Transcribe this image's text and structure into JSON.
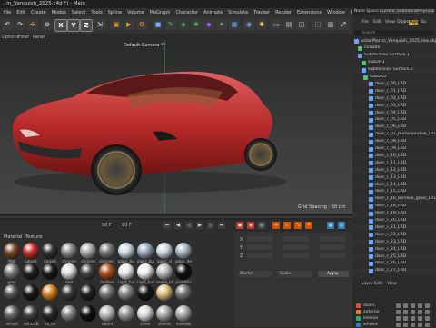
{
  "window": {
    "title": "...in_Vanquish_2025.c4d *] - Main"
  },
  "menubar": [
    "File",
    "Edit",
    "Create",
    "Modes",
    "Select",
    "Tools",
    "Spline",
    "Volume",
    "MoGraph",
    "Character",
    "Animate",
    "Simulate",
    "Tracker",
    "Render",
    "Extensions",
    "Window",
    "Help"
  ],
  "toolbar": {
    "axis_x": "X",
    "axis_y": "Y",
    "axis_z": "Z"
  },
  "viewport_menu": [
    "Options",
    "Filter",
    "Panel"
  ],
  "viewport": {
    "camera_label": "Default Camera *°",
    "grid_spacing": "Grid Spacing : 50 cm"
  },
  "timeline": {
    "frame_left": "90 F",
    "frame_right": "90 F"
  },
  "material_panel": {
    "menu": [
      "Material",
      "Texture"
    ],
    "rows": [
      [
        "Mat",
        "carpet",
        "carpet",
        "chrome",
        "chrome",
        "chrome_",
        "glass_bu",
        "glass_bu",
        "glass_cl",
        "glass_de"
      ],
      [
        "grey",
        "",
        "",
        "met",
        "",
        "leather",
        "Light_bul",
        "Light_bul",
        "metal_bl",
        "paintBla"
      ],
      [
        "",
        "",
        "",
        "",
        "",
        "",
        "",
        "",
        "",
        ""
      ],
      [
        "refract",
        "refractB",
        "ha_ne",
        "",
        "",
        "swarn",
        "",
        "silver",
        "silverb",
        "mixedbl"
      ]
    ]
  },
  "attr_panel": {
    "coords": [
      "X",
      "Y",
      "Z"
    ],
    "world": "World",
    "scale": "Scale",
    "apply": "Apply"
  },
  "right_panel": {
    "node_space_label": "Node Space",
    "node_space_value": "Current (Standard/Physical)",
    "menu": [
      "File",
      "Edit",
      "View",
      "Object",
      "Tags",
      "Bo"
    ],
    "search": "Search",
    "objects": [
      "AstonMartin_Vanquish_2025_low.obj",
      "noSub0",
      "Subdivision Surface.1",
      "subDiv1",
      "Subdivision Surface.2",
      "subDiv2",
      "door_r_00_LRD",
      "door_r_01_LRD",
      "door_r_02_LRD",
      "door_r_03_LRD",
      "door_r_04_LRD",
      "door_r_05_LRD",
      "door_r_06_LRD",
      "door_r_07_mirrorwindow_LRD",
      "door_r_08_LRD",
      "door_r_09_LRD",
      "door_r_10_LRD",
      "door_r_11_LRD",
      "door_r_12_LRD",
      "door_r_13_LRD",
      "door_r_14_LRD",
      "door_r_15_LRD",
      "door_r_16_window_glass_LRD",
      "door_r_18_LRD",
      "door_r_19_LRD",
      "door_r_20_LRD",
      "door_r_21_LRD",
      "door_r_22_LRD",
      "door_r_23_LRD",
      "door_r_24_LRD",
      "door_r_25_LRD",
      "door_r_26_LRD",
      "door_r_27_LRD"
    ],
    "layer_menu": [
      "Layer",
      "Edit",
      "View"
    ],
    "layers": [
      {
        "name": "doors",
        "color": "#e74c3c"
      },
      {
        "name": "exterior",
        "color": "#e67e22"
      },
      {
        "name": "interior",
        "color": "#27ae60"
      },
      {
        "name": "wheels",
        "color": "#2980b9"
      }
    ]
  }
}
